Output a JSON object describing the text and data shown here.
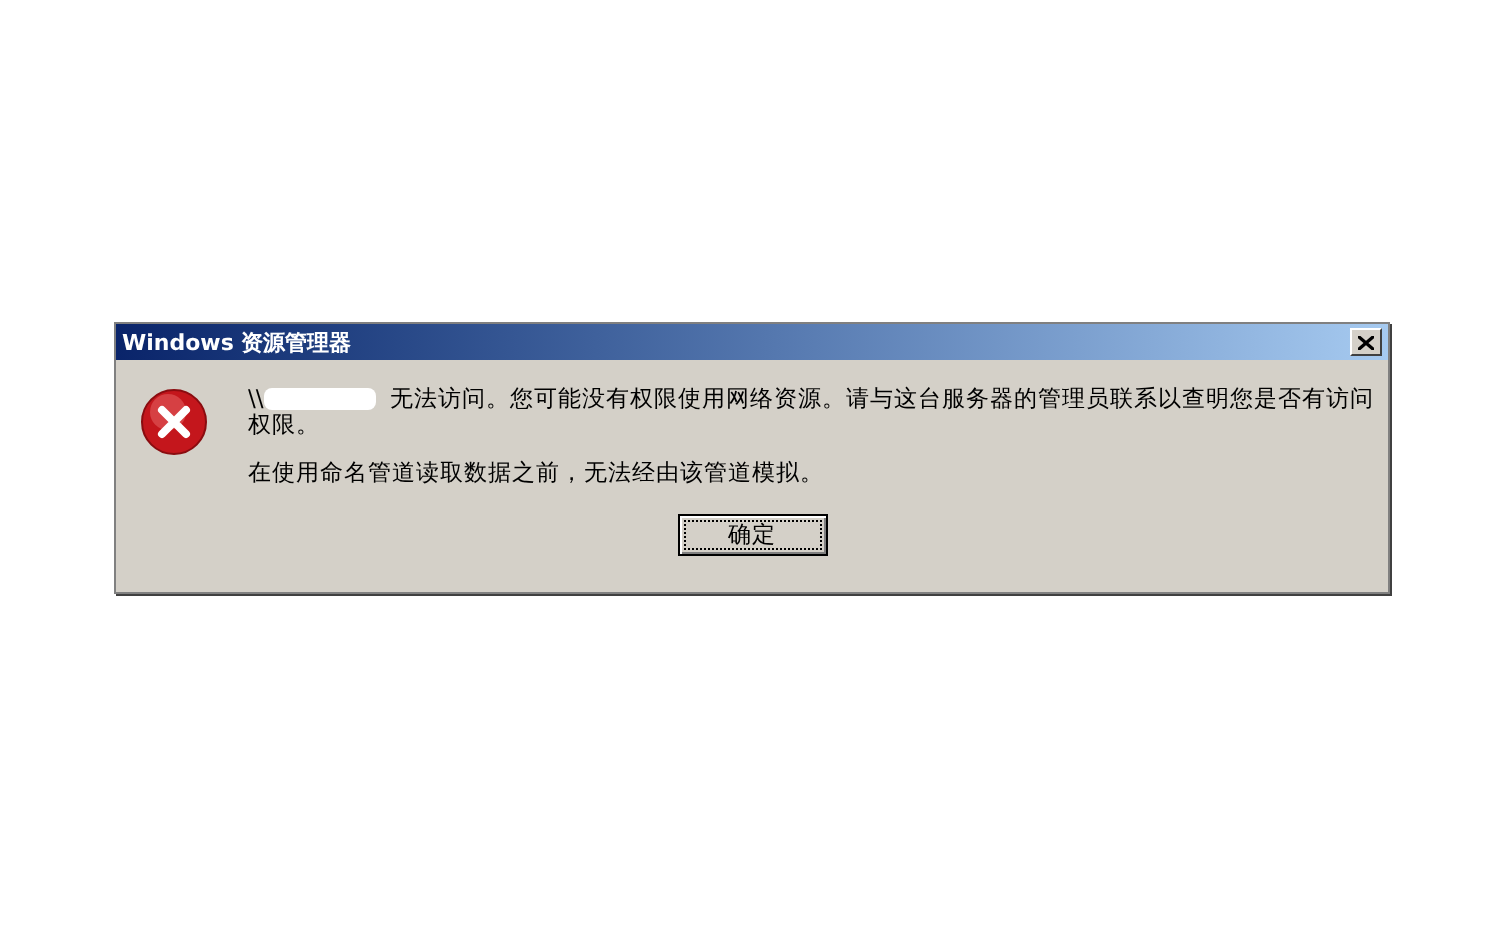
{
  "window": {
    "title": "Windows 资源管理器"
  },
  "message": {
    "prefix": "\\\\",
    "lines": [
      "无法访问。您可能没有权限使用网络资源。请与这台服务器的管理员联系以查明您是否有访问",
      "权限。"
    ],
    "detail": "在使用命名管道读取数据之前，无法经由该管道模拟。"
  },
  "buttons": [
    {
      "label": "确定",
      "selected": true
    }
  ]
}
